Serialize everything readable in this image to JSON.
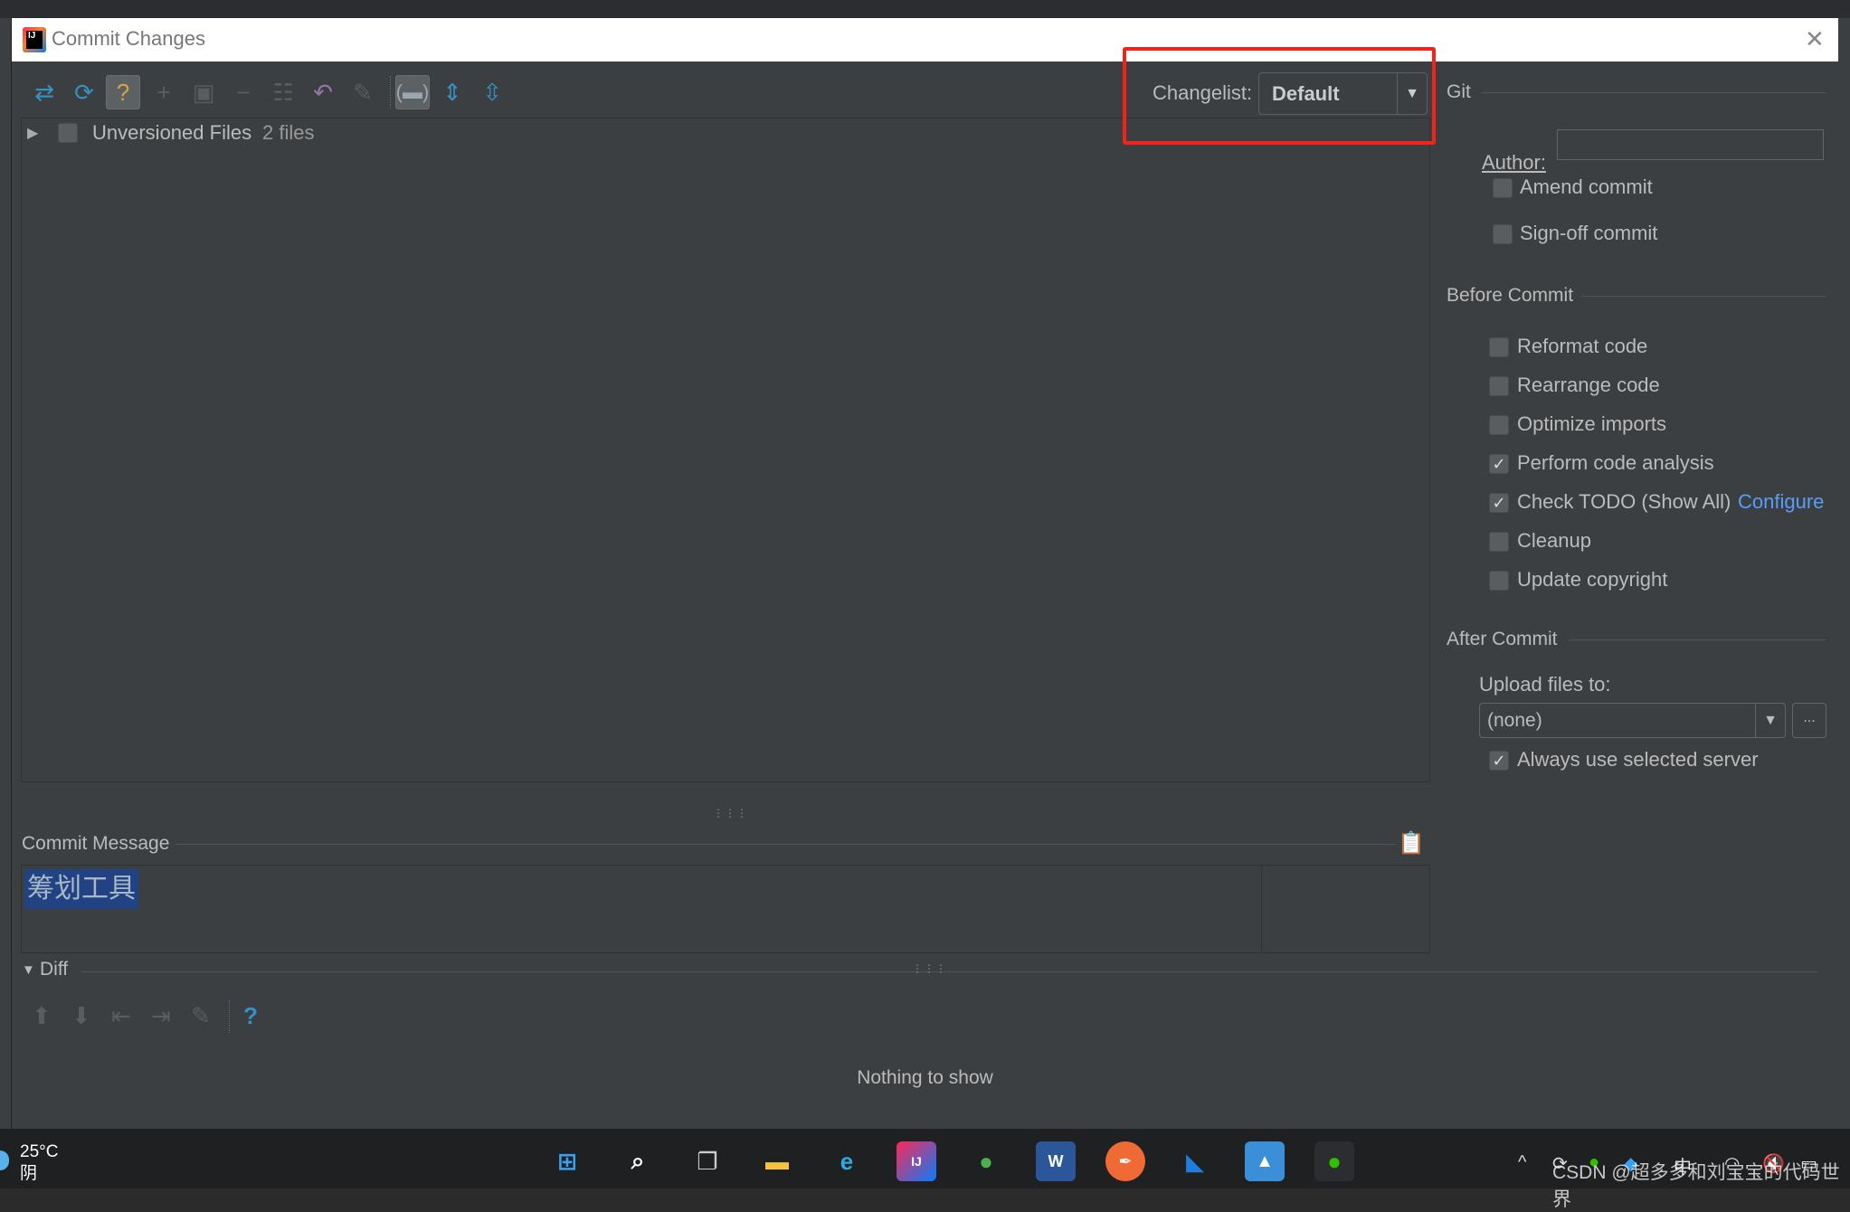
{
  "window": {
    "title": "Commit Changes",
    "app_icon_text": "IJ"
  },
  "toolbar": {
    "icons": [
      "diff-icon",
      "refresh-icon",
      "unversioned-files-icon",
      "add-icon",
      "move-icon",
      "remove-icon",
      "group-by-icon",
      "revert-icon",
      "edit-source-icon",
      "show-folders-icon",
      "expand-all-icon",
      "collapse-all-icon"
    ]
  },
  "changes": {
    "group_label": "Unversioned Files",
    "group_count": "2 files"
  },
  "changelist": {
    "label": "Changelist:",
    "value": "Default"
  },
  "git": {
    "header": "Git",
    "author_label": "Author:",
    "author_value": "",
    "options": [
      {
        "label": "Amend commit",
        "checked": false
      },
      {
        "label": "Sign-off commit",
        "checked": false
      }
    ]
  },
  "before_commit": {
    "header": "Before Commit",
    "options": [
      {
        "label": "Reformat code",
        "checked": false
      },
      {
        "label": "Rearrange code",
        "checked": false
      },
      {
        "label": "Optimize imports",
        "checked": false
      },
      {
        "label": "Perform code analysis",
        "checked": true
      },
      {
        "label": "Check TODO (Show All)",
        "checked": true,
        "link": "Configure"
      },
      {
        "label": "Cleanup",
        "checked": false
      },
      {
        "label": "Update copyright",
        "checked": false
      }
    ]
  },
  "after_commit": {
    "header": "After Commit",
    "upload_label": "Upload files to:",
    "upload_value": "(none)",
    "browse_label": "...",
    "always_label": "Always use selected server",
    "always_checked": true
  },
  "commit_message": {
    "label": "Commit Message",
    "value": "筹划工具"
  },
  "diff": {
    "label": "Diff",
    "empty_text": "Nothing to show"
  },
  "taskbar": {
    "weather_temp": "25°C",
    "weather_desc": "阴",
    "apps": [
      "windows-start",
      "search",
      "task-view",
      "file-explorer",
      "edge",
      "intellij-idea",
      "app-green",
      "word",
      "app-orange",
      "app-blue",
      "photos",
      "wechat"
    ],
    "tray_ime": "中"
  },
  "watermark": "CSDN @超多多和刘宝宝的代码世界",
  "colors": {
    "highlight_box": "#f3231a",
    "selection": "#214283",
    "link": "#589df6",
    "panel": "#3c3f41"
  }
}
